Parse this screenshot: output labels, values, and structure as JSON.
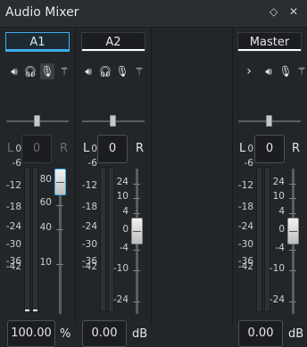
{
  "window": {
    "title": "Audio Mixer",
    "float_icon": "◇",
    "close_icon": "✕"
  },
  "colors": {
    "accent": "#3daee9",
    "background": "#232629"
  },
  "channels": [
    {
      "name": "A1",
      "active": true,
      "icons": [
        "speaker-icon",
        "headphones-icon",
        "microphone-icon",
        "magic-wand-icon"
      ],
      "balance_left": "L",
      "balance_value": "0",
      "balance_right": "R",
      "meter_scale": [
        "0",
        "-6",
        "-12",
        "-18",
        "-24",
        "-30",
        "-36",
        "-42"
      ],
      "fader_scale": [
        "80",
        "60",
        "40",
        "10"
      ],
      "value": "100.00",
      "unit": "%"
    },
    {
      "name": "A2",
      "active": false,
      "icons": [
        "speaker-icon",
        "headphones-icon",
        "microphone-icon",
        "magic-wand-icon"
      ],
      "balance_left": "L",
      "balance_value": "0",
      "balance_right": "R",
      "meter_scale": [
        "0",
        "-6",
        "-12",
        "-18",
        "-24",
        "-30",
        "-36",
        "-42"
      ],
      "fader_scale": [
        "24",
        "10",
        "4",
        "0",
        "-4",
        "-10",
        "-24"
      ],
      "value": "0.00",
      "unit": "dB"
    },
    {
      "name": "Master",
      "active": false,
      "icons": [
        "chevron-right-icon",
        "speaker-icon",
        "microphone-icon",
        "magic-wand-icon"
      ],
      "balance_left": "L",
      "balance_value": "0",
      "balance_right": "R",
      "meter_scale": [
        "0",
        "-6",
        "-12",
        "-18",
        "-24",
        "-30",
        "-36",
        "-42"
      ],
      "fader_scale": [
        "24",
        "10",
        "4",
        "0",
        "-4",
        "-10",
        "-24"
      ],
      "value": "0.00",
      "unit": "dB"
    }
  ]
}
